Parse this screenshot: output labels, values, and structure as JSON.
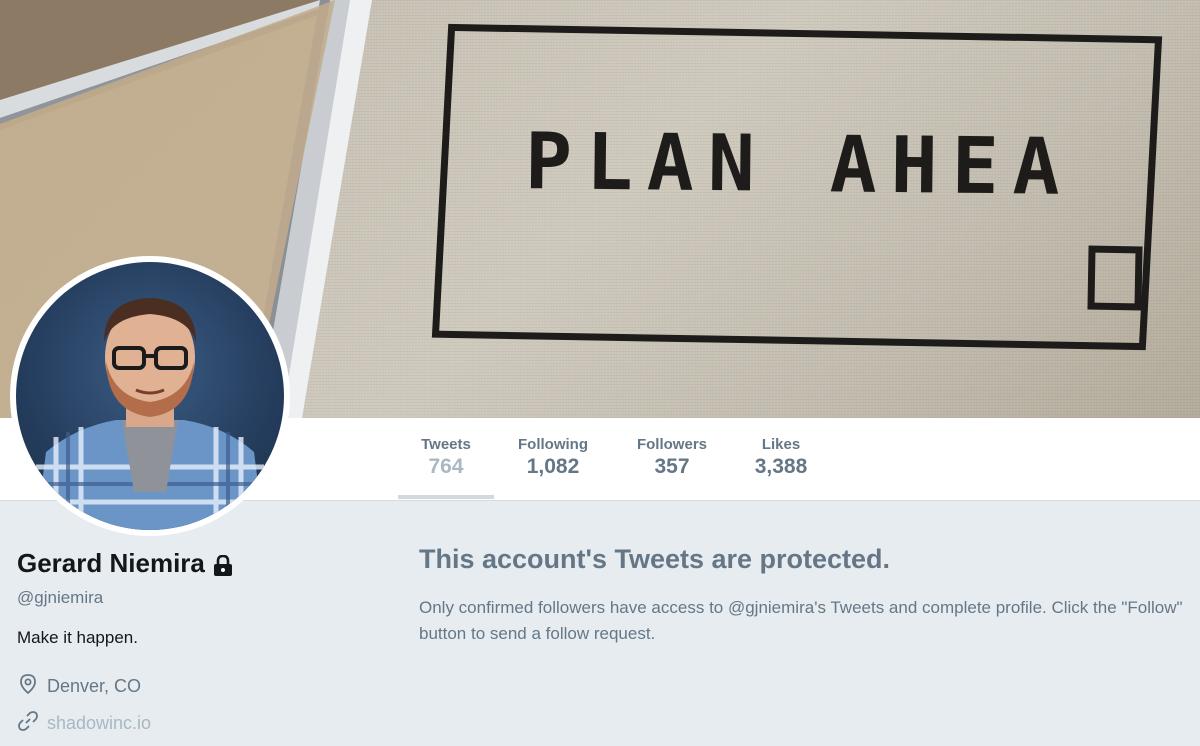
{
  "banner": {
    "text": "PLAN AHEA"
  },
  "profile": {
    "name": "Gerard Niemira",
    "handle": "@gjniemira",
    "bio": "Make it happen.",
    "location": "Denver, CO",
    "url": "shadowinc.io",
    "protected_icon": "lock-icon"
  },
  "stats": [
    {
      "label": "Tweets",
      "value": "764",
      "active": true
    },
    {
      "label": "Following",
      "value": "1,082",
      "active": false
    },
    {
      "label": "Followers",
      "value": "357",
      "active": false
    },
    {
      "label": "Likes",
      "value": "3,388",
      "active": false
    }
  ],
  "protected": {
    "title": "This account's Tweets are protected.",
    "body": "Only confirmed followers have access to @gjniemira's Tweets and complete profile. Click the \"Follow\" button to send a follow request."
  },
  "colors": {
    "page_background": "#e6ecf0",
    "muted_text": "#657786",
    "primary_text": "#14171a",
    "active_value": "#aab8c2"
  }
}
